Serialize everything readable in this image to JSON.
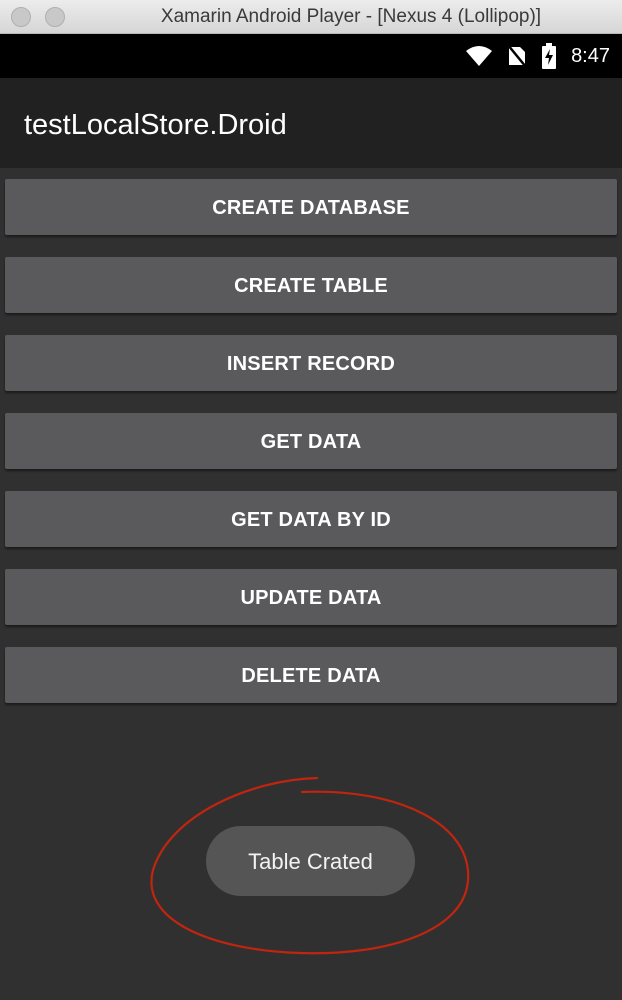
{
  "window": {
    "title": "Xamarin Android Player - [Nexus 4 (Lollipop)]"
  },
  "statusbar": {
    "icons": [
      "wifi-icon",
      "no-sim-icon",
      "battery-charging-icon"
    ],
    "time": "8:47"
  },
  "actionbar": {
    "title": "testLocalStore.Droid"
  },
  "buttons": [
    {
      "label": "CREATE DATABASE"
    },
    {
      "label": "CREATE TABLE"
    },
    {
      "label": "INSERT RECORD"
    },
    {
      "label": "GET DATA"
    },
    {
      "label": "GET DATA BY ID"
    },
    {
      "label": "UPDATE DATA"
    },
    {
      "label": "DELETE DATA"
    }
  ],
  "toast": {
    "message": "Table Crated"
  },
  "colors": {
    "status_bar": "#000000",
    "action_bar": "#212121",
    "background": "#303030",
    "button": "#5a5a5c",
    "toast": "#555555",
    "annotation": "#c0250f"
  }
}
